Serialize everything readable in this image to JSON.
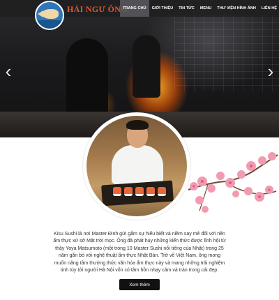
{
  "brand": {
    "name": "HẢI NGƯ ÔNG",
    "logo_icon": "fish-logo-icon"
  },
  "nav": {
    "items": [
      {
        "label": "TRANG CHỦ",
        "active": true
      },
      {
        "label": "GIỚI THIỆU",
        "active": false
      },
      {
        "label": "TIN TỨC",
        "active": false
      },
      {
        "label": "MENU",
        "active": false
      },
      {
        "label": "THƯ VIỆN HÌNH ẢNH",
        "active": false
      },
      {
        "label": "LIÊN HỆ",
        "active": false
      }
    ]
  },
  "slider": {
    "prev_icon": "chevron-left-icon",
    "next_icon": "chevron-right-icon",
    "prev_glyph": "‹",
    "next_glyph": "›"
  },
  "intro": {
    "text": "Kisu Sushi là nơi Master Đinh gửi gắm sự hiểu biết và niềm say mê đối với nền ẩm thực xứ sở Mặt trời mọc. Ông đã phát huy những kiến thức được lĩnh hội từ thầy Yoya Matsumoto (một trong 10 Master Sushi nổi tiếng của Nhật) trong 25 năm gắn bó với nghệ thuật ẩm thực Nhật Bản. Trở về Việt Nam, ông mong muốn nâng tầm thưởng thức văn hóa ẩm thực này và mang những trải nghiệm tinh túy tới người Hà Nội vốn có tâm hồn nhạy cảm và tràn trong cái đẹp.",
    "button_label": "Xem thêm"
  },
  "colors": {
    "brand": "#e4572e",
    "nav_bg": "#1e1e20",
    "button_bg": "#111111",
    "blossom": "#f29bb0"
  }
}
